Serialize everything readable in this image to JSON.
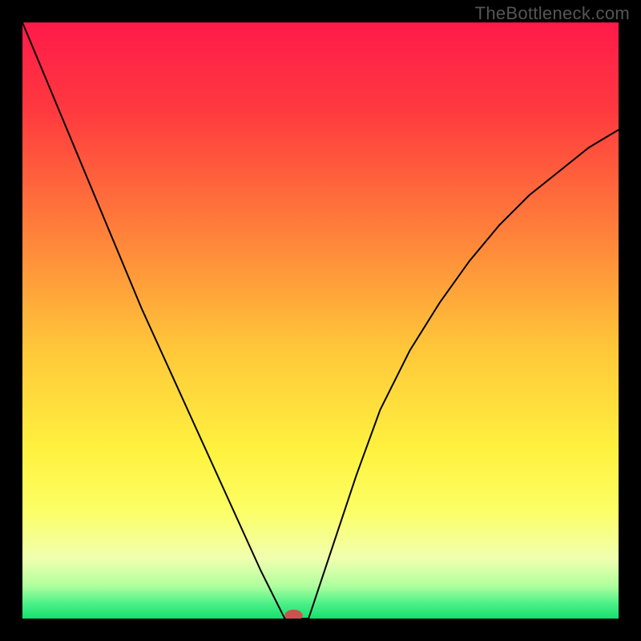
{
  "watermark": "TheBottleneck.com",
  "chart_data": {
    "type": "line",
    "title": "",
    "xlabel": "",
    "ylabel": "",
    "xlim": [
      0,
      100
    ],
    "ylim": [
      0,
      100
    ],
    "background_gradient": {
      "stops": [
        {
          "offset": 0.0,
          "color": "#ff1a4a"
        },
        {
          "offset": 0.15,
          "color": "#ff3a3f"
        },
        {
          "offset": 0.35,
          "color": "#ff803a"
        },
        {
          "offset": 0.55,
          "color": "#ffc83a"
        },
        {
          "offset": 0.72,
          "color": "#fff23f"
        },
        {
          "offset": 0.82,
          "color": "#fcff66"
        },
        {
          "offset": 0.9,
          "color": "#f0ffb0"
        },
        {
          "offset": 0.945,
          "color": "#b0ff9e"
        },
        {
          "offset": 0.975,
          "color": "#4cf087"
        },
        {
          "offset": 1.0,
          "color": "#14e06e"
        }
      ]
    },
    "series": [
      {
        "name": "bottleneck-curve",
        "x": [
          0,
          5,
          10,
          15,
          20,
          25,
          30,
          35,
          40,
          43,
          44,
          44,
          48,
          49,
          52,
          56,
          60,
          65,
          70,
          75,
          80,
          85,
          90,
          95,
          100
        ],
        "y": [
          100,
          88,
          76,
          64,
          52,
          41,
          30,
          19,
          8,
          2,
          0,
          0,
          0,
          3,
          12,
          24,
          35,
          45,
          53,
          60,
          66,
          71,
          75,
          79,
          82
        ]
      }
    ],
    "marker": {
      "name": "bottleneck-point",
      "x": 45.5,
      "y": 0.5,
      "rx": 1.5,
      "ry": 1.0,
      "color": "#d05050"
    }
  }
}
